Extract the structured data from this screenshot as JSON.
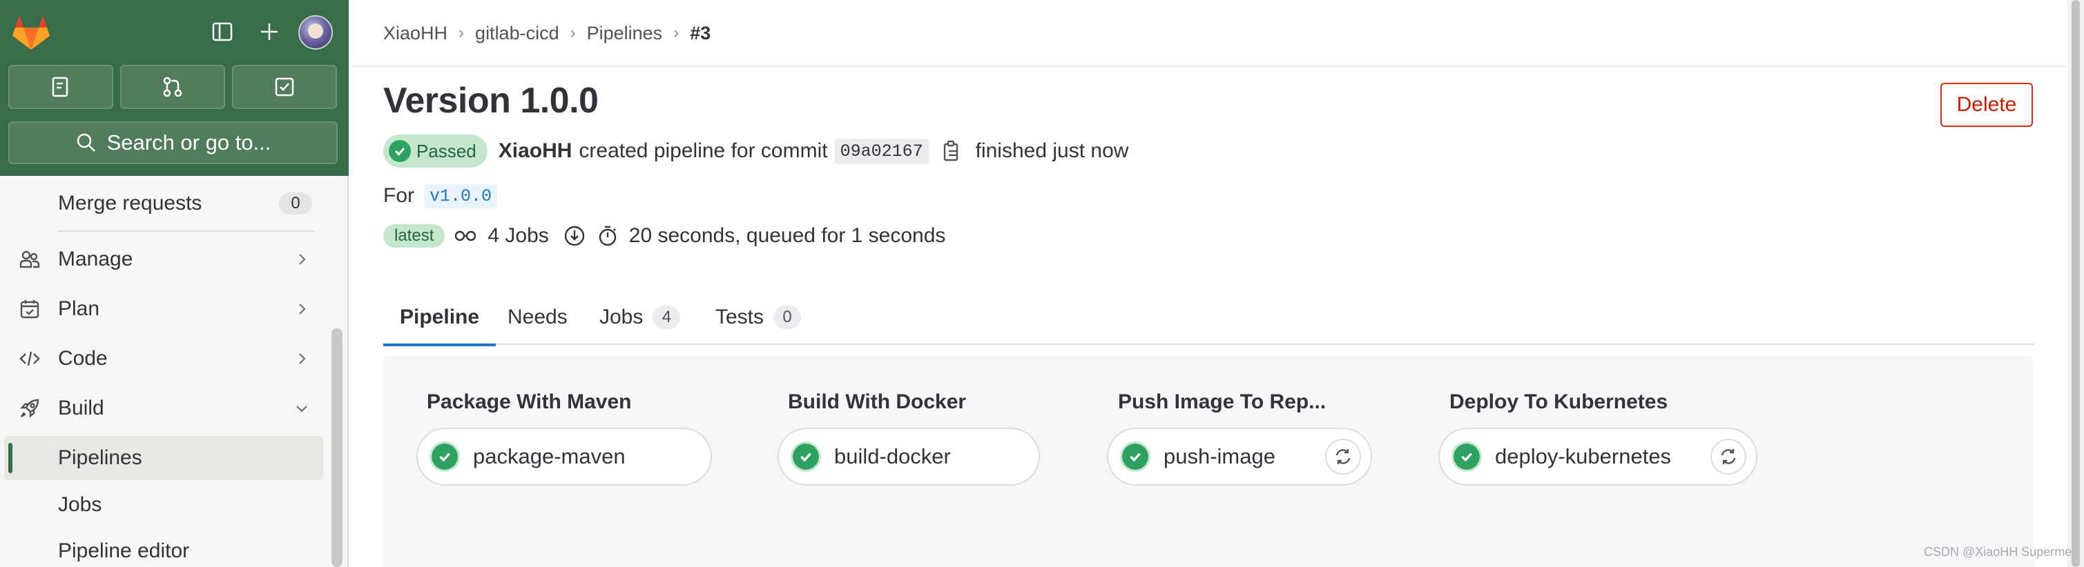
{
  "sidebar": {
    "search_label": "Search or go to...",
    "items": {
      "merge_requests": {
        "label": "Merge requests",
        "count": "0"
      },
      "manage": {
        "label": "Manage"
      },
      "plan": {
        "label": "Plan"
      },
      "code": {
        "label": "Code"
      },
      "build": {
        "label": "Build"
      },
      "pipelines": {
        "label": "Pipelines"
      },
      "jobs": {
        "label": "Jobs"
      },
      "pipeline_editor": {
        "label": "Pipeline editor"
      }
    },
    "active_item": "Pipelines"
  },
  "breadcrumb": {
    "items": [
      "XiaoHH",
      "gitlab-cicd",
      "Pipelines",
      "#3"
    ],
    "separator": "›"
  },
  "pipeline": {
    "title": "Version 1.0.0",
    "delete_label": "Delete",
    "status_label": "Passed",
    "author": "XiaoHH",
    "created_text": "created pipeline for commit",
    "commit_sha": "09a02167",
    "finished_text": "finished just now",
    "for_label": "For",
    "ref": "v1.0.0",
    "latest_label": "latest",
    "jobs_text": "4 Jobs",
    "duration_text": "20 seconds, queued for 1 seconds"
  },
  "tabs": [
    {
      "label": "Pipeline",
      "active": true
    },
    {
      "label": "Needs"
    },
    {
      "label": "Jobs",
      "count": "4"
    },
    {
      "label": "Tests",
      "count": "0"
    }
  ],
  "stages": [
    {
      "title": "Package With Maven",
      "job": "package-maven",
      "retry": false
    },
    {
      "title": "Build With Docker",
      "job": "build-docker",
      "retry": false
    },
    {
      "title": "Push Image To Rep...",
      "job": "push-image",
      "retry": true
    },
    {
      "title": "Deploy To Kubernetes",
      "job": "deploy-kubernetes",
      "retry": true
    }
  ],
  "watermark": "CSDN @XiaoHH Superme",
  "colors": {
    "sidebar_top": "#396c48",
    "success": "#2da160",
    "danger": "#dd2b0e",
    "link": "#1f75cb"
  }
}
